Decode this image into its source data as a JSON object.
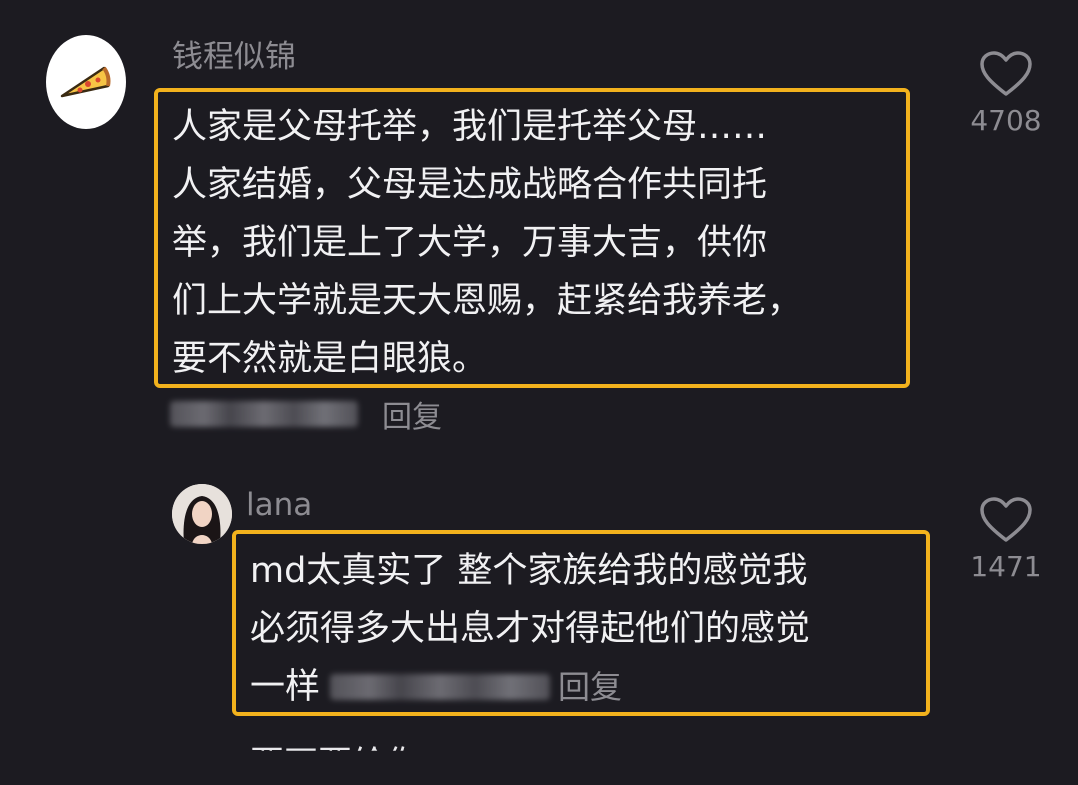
{
  "comments": [
    {
      "username": "钱程似锦",
      "avatar_icon": "pizza-icon",
      "lines": [
        "人家是父母托举，我们是托举父母……",
        "人家结婚，父母是达成战略合作共同托",
        "举，我们是上了大学，万事大吉，供你",
        "们上大学就是天大恩赐，赶紧给我养老，",
        "要不然就是白眼狼。"
      ],
      "reply_label": "回复",
      "like_count": "4708"
    },
    {
      "username": "lana",
      "avatar_icon": "girl-avatar-icon",
      "lines": [
        "md太真实了 整个家族给我的感觉我",
        "必须得多大出息才对得起他们的感觉",
        "一样"
      ],
      "reply_label": "回复",
      "like_count": "1471"
    }
  ],
  "next_preview_text": "要不要给你"
}
